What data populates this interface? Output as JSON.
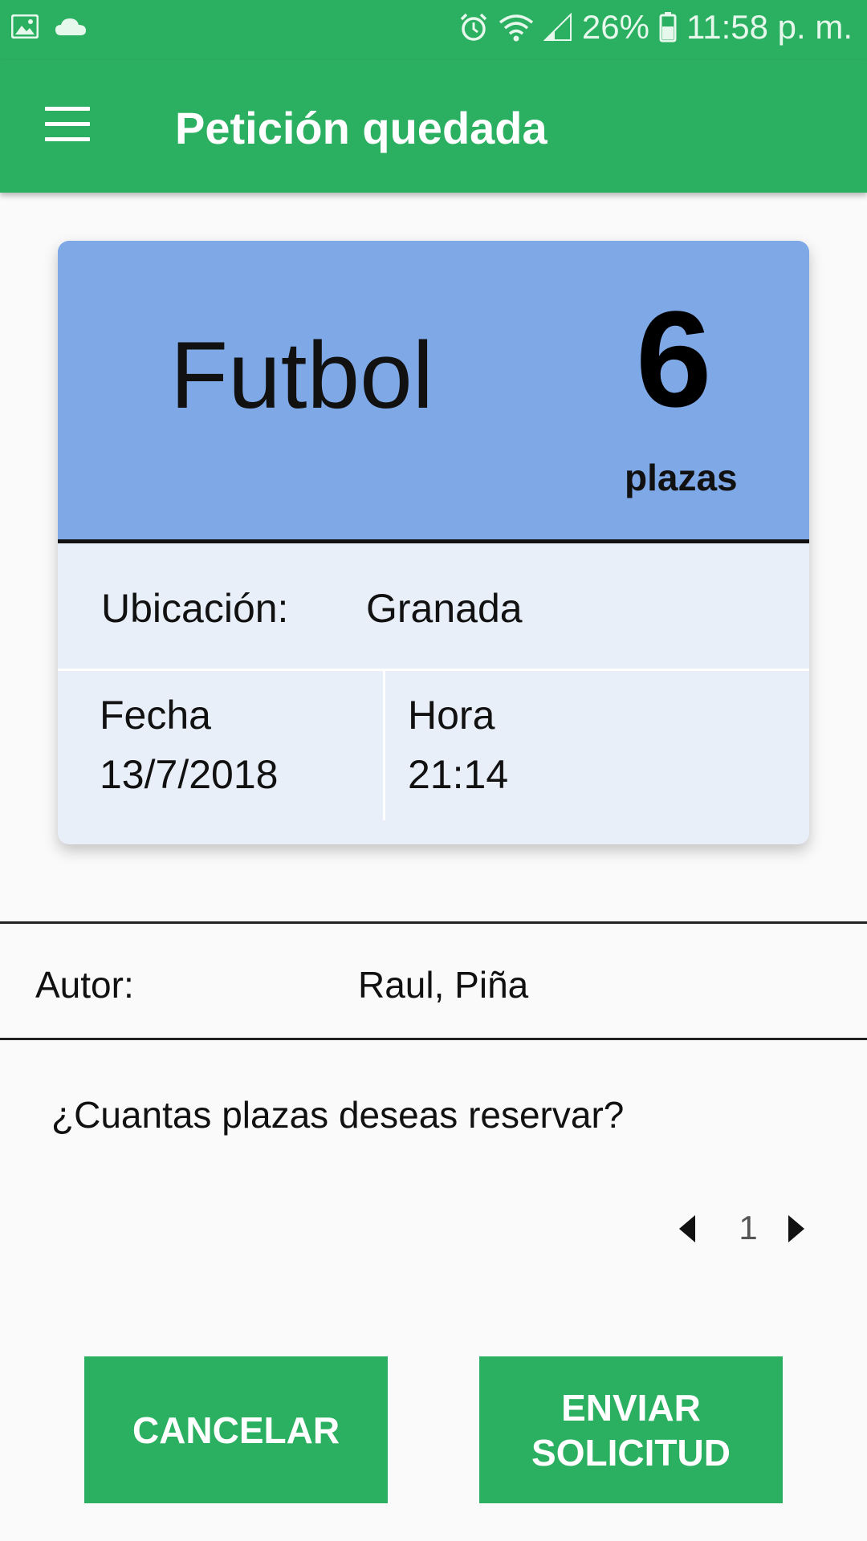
{
  "status_bar": {
    "battery": "26%",
    "time": "11:58 p. m."
  },
  "app_bar": {
    "title": "Petición quedada"
  },
  "event": {
    "sport": "Futbol",
    "places_count": "6",
    "places_label": "plazas",
    "location_label": "Ubicación:",
    "location_value": "Granada",
    "date_label": "Fecha",
    "date_value": "13/7/2018",
    "hour_label": "Hora",
    "hour_value": "21:14"
  },
  "author": {
    "label": "Autor:",
    "value": "Raul, Piña"
  },
  "reservation": {
    "question": "¿Cuantas plazas deseas reservar?",
    "stepper_value": "1"
  },
  "buttons": {
    "cancel": "CANCELAR",
    "send_line1": "ENVIAR",
    "send_line2": "SOLICITUD"
  },
  "colors": {
    "primary": "#2baf60",
    "card_header": "#7fa8e6",
    "card_body": "#e8eff9"
  }
}
